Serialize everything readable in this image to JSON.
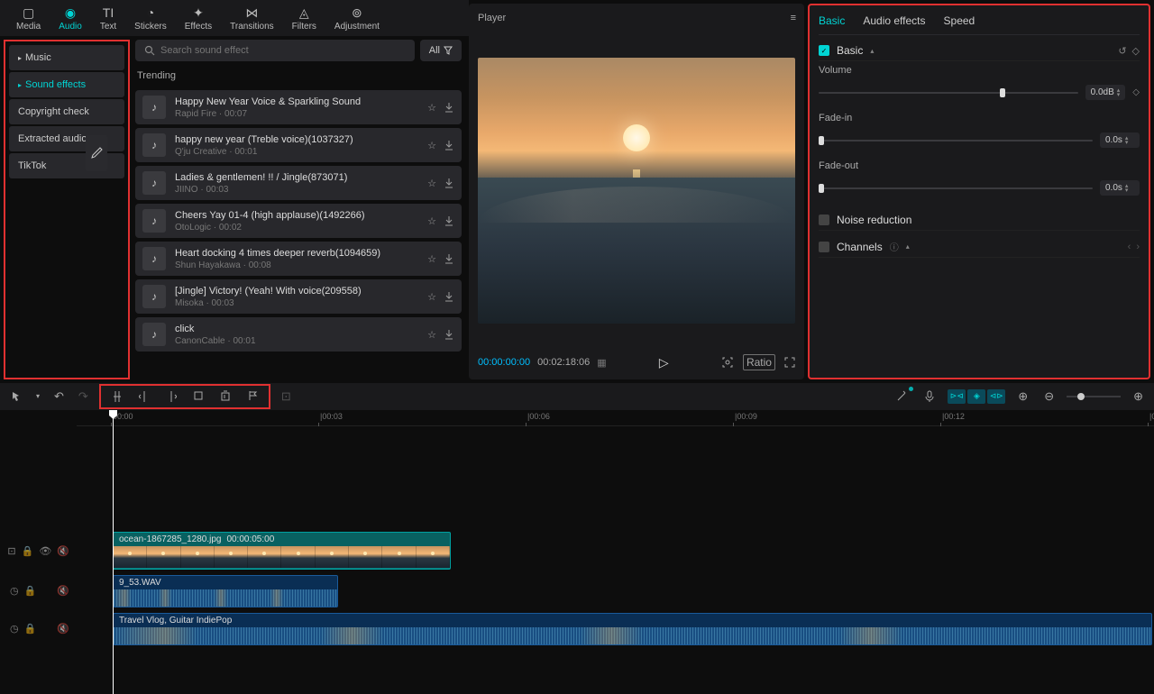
{
  "topTabs": [
    {
      "label": "Media",
      "icon": "▢"
    },
    {
      "label": "Audio",
      "icon": "◉",
      "active": true
    },
    {
      "label": "Text",
      "icon": "TI"
    },
    {
      "label": "Stickers",
      "icon": "◔"
    },
    {
      "label": "Effects",
      "icon": "✦"
    },
    {
      "label": "Transitions",
      "icon": "⋈"
    },
    {
      "label": "Filters",
      "icon": "◬"
    },
    {
      "label": "Adjustment",
      "icon": "⊚"
    }
  ],
  "sidebar": [
    {
      "label": "Music",
      "expand": true
    },
    {
      "label": "Sound effects",
      "expand": true,
      "active": true
    },
    {
      "label": "Copyright check"
    },
    {
      "label": "Extracted audios"
    },
    {
      "label": "TikTok"
    }
  ],
  "search": {
    "placeholder": "Search sound effect"
  },
  "allBtn": "All",
  "trending": "Trending",
  "sounds": [
    {
      "title": "Happy New Year Voice & Sparkling Sound",
      "meta": "Rapid Fire · 00:07"
    },
    {
      "title": "happy new year (Treble voice)(1037327)",
      "meta": "Q'ju Creative · 00:01"
    },
    {
      "title": "Ladies & gentlemen! !! / Jingle(873071)",
      "meta": "JIINO · 00:03"
    },
    {
      "title": "Cheers Yay 01-4 (high applause)(1492266)",
      "meta": "OtoLogic · 00:02"
    },
    {
      "title": "Heart docking 4 times deeper reverb(1094659)",
      "meta": "Shun Hayakawa · 00:08"
    },
    {
      "title": "[Jingle] Victory! (Yeah! With voice(209558)",
      "meta": "Misoka · 00:03"
    },
    {
      "title": "click",
      "meta": "CanonCable · 00:01"
    }
  ],
  "player": {
    "title": "Player",
    "time_current": "00:00:00:00",
    "time_total": "00:02:18:06",
    "ratio": "Ratio"
  },
  "rightTabs": [
    {
      "label": "Basic",
      "active": true
    },
    {
      "label": "Audio effects"
    },
    {
      "label": "Speed"
    }
  ],
  "props": {
    "basic": "Basic",
    "volume_label": "Volume",
    "volume_value": "0.0dB",
    "fadein_label": "Fade-in",
    "fadein_value": "0.0s",
    "fadeout_label": "Fade-out",
    "fadeout_value": "0.0s",
    "noise": "Noise reduction",
    "channels": "Channels"
  },
  "ruler": [
    "00:00",
    "|00:03",
    "|00:06",
    "|00:09",
    "|00:12",
    "|00"
  ],
  "clips": {
    "video_name": "ocean-1867285_1280.jpg",
    "video_dur": "00:00:05:00",
    "audio1": "9_53.WAV",
    "audio2": "Travel Vlog, Guitar IndiePop"
  }
}
